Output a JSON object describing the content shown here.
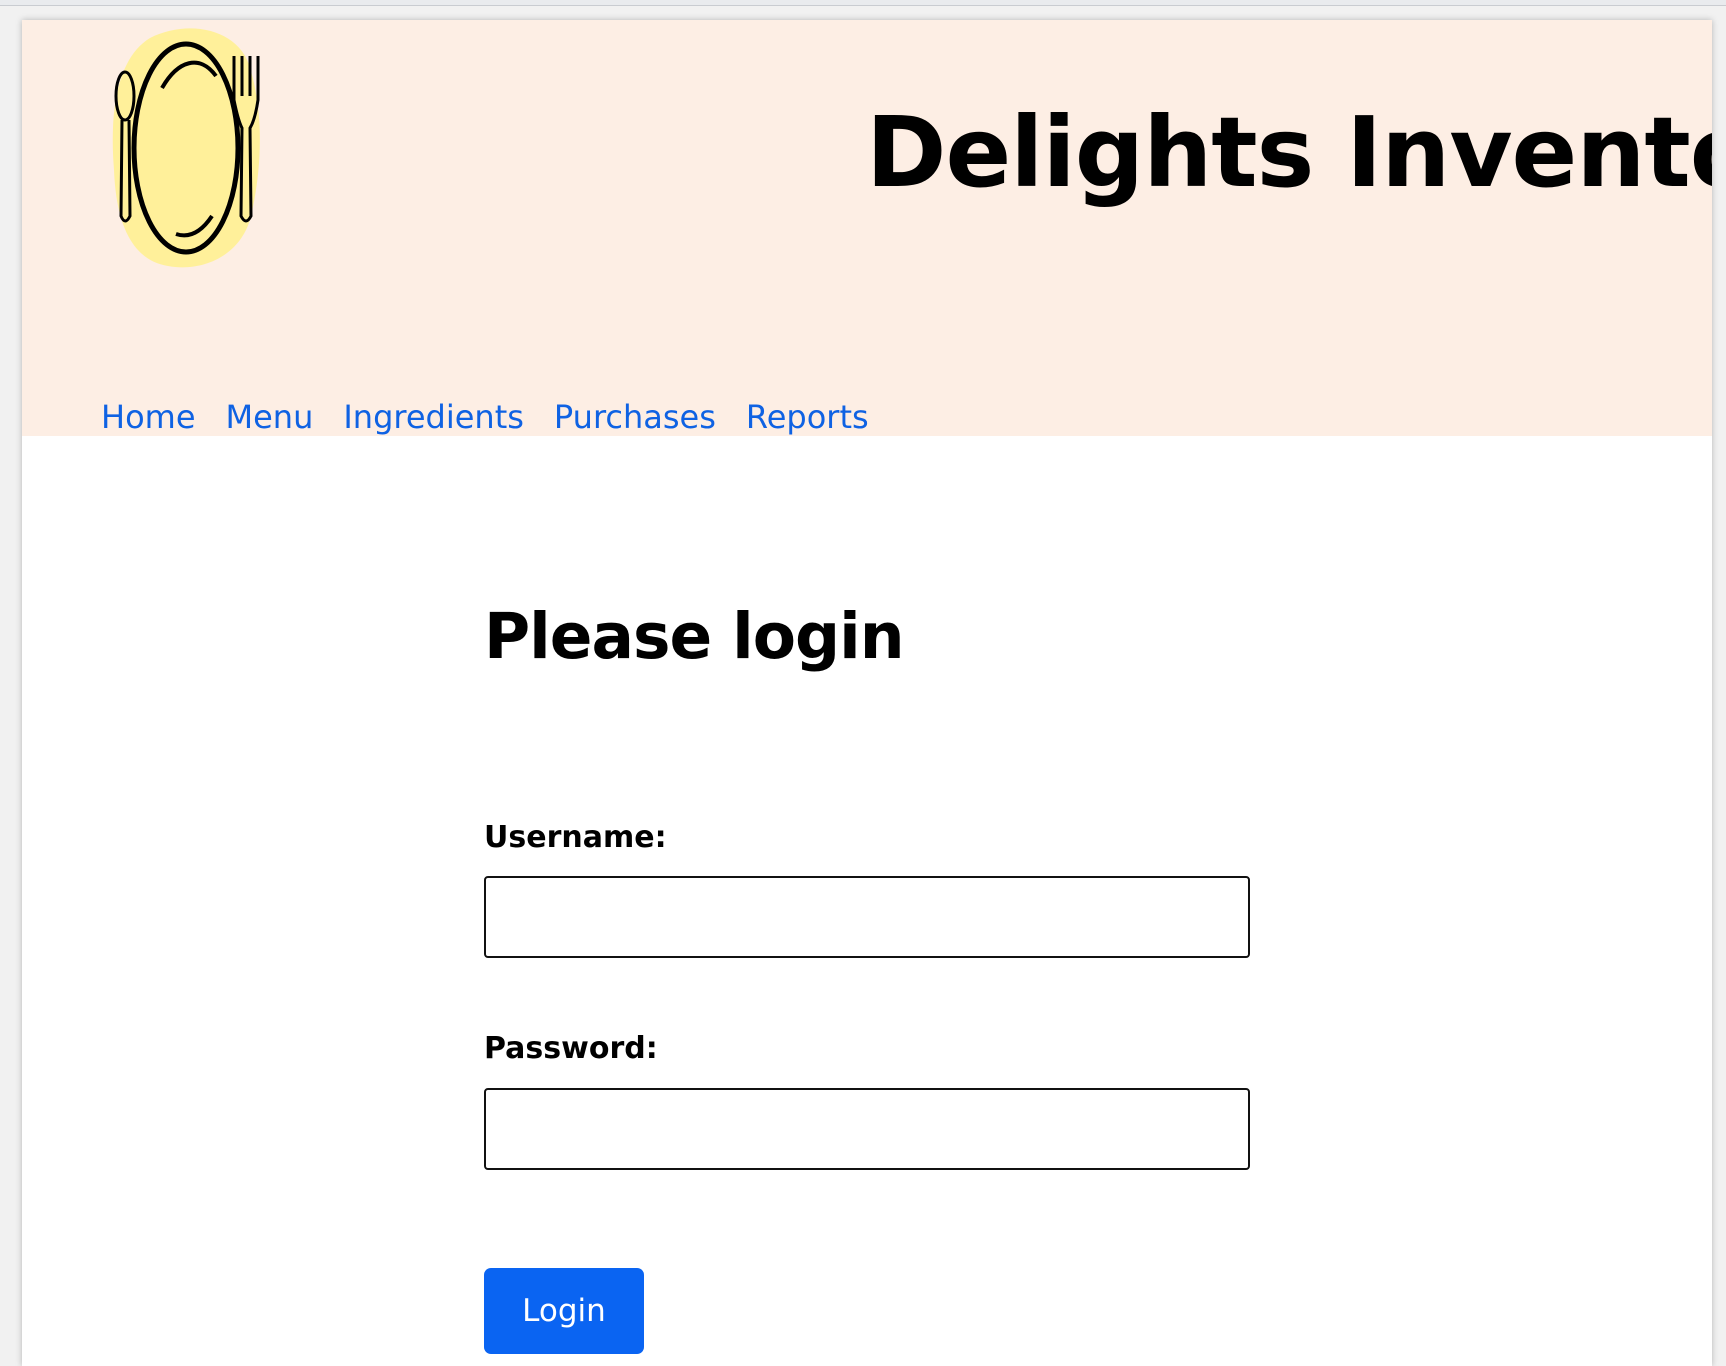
{
  "header": {
    "site_title": "Delights Inventory",
    "logo_icon": "plate-fork-spoon-logo"
  },
  "nav": {
    "items": [
      {
        "label": "Home"
      },
      {
        "label": "Menu"
      },
      {
        "label": "Ingredients"
      },
      {
        "label": "Purchases"
      },
      {
        "label": "Reports"
      }
    ]
  },
  "login": {
    "heading": "Please login",
    "username_label": "Username:",
    "username_value": "",
    "password_label": "Password:",
    "password_value": "",
    "submit_label": "Login"
  },
  "colors": {
    "header_background": "#fdeee4",
    "link": "#0f62e3",
    "button": "#0a64f2",
    "logo_blob": "#fff09a"
  }
}
